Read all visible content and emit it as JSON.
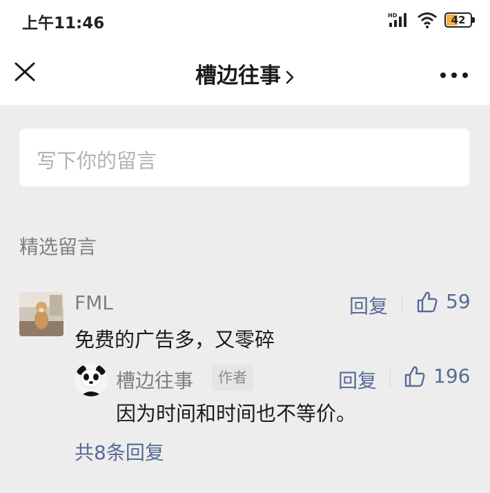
{
  "status": {
    "time": "上午11:46",
    "network_label": "HD",
    "battery": "42"
  },
  "nav": {
    "title": "槽边往事",
    "close_icon": "close-icon",
    "more_icon": "more-dots-icon"
  },
  "input": {
    "placeholder": "写下你的留言"
  },
  "section_title": "精选留言",
  "comment": {
    "name": "FML",
    "text": "免费的广告多，又零碎",
    "reply_label": "回复",
    "likes": "59",
    "reply": {
      "name": "槽边往事",
      "badge": "作者",
      "text": "因为时间和时间也不等价。",
      "reply_label": "回复",
      "likes": "196"
    },
    "more_replies": "共8条回复"
  },
  "colors": {
    "link": "#576b95",
    "meta": "#7f7f7f",
    "background": "#ededed"
  }
}
